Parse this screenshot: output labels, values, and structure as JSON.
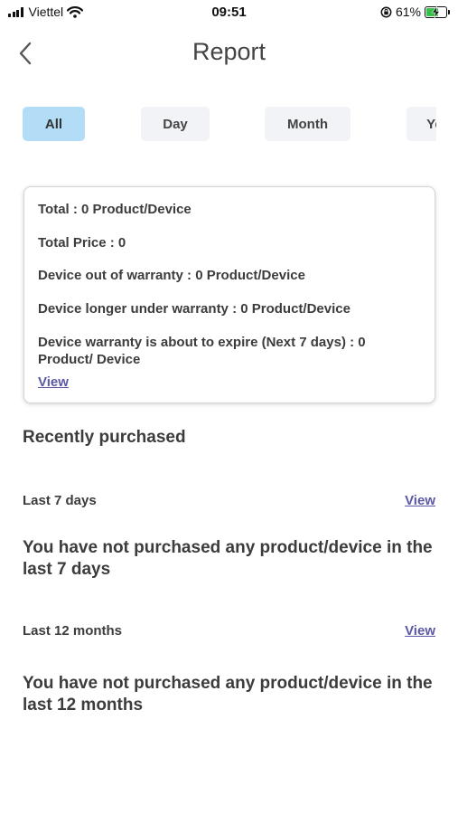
{
  "status_bar": {
    "carrier": "Viettel",
    "time": "09:51",
    "battery": "61%",
    "battery_level": 0.61,
    "icons": [
      "signal-icon",
      "wifi-icon",
      "orientation-lock-icon",
      "battery-charging-icon"
    ]
  },
  "header": {
    "title": "Report",
    "back_icon": "chevron-left-icon"
  },
  "tabs": [
    {
      "label": "All",
      "active": true
    },
    {
      "label": "Day",
      "active": false
    },
    {
      "label": "Month",
      "active": false
    },
    {
      "label": "Year",
      "active": false
    }
  ],
  "summary": {
    "total": "Total : 0 Product/Device",
    "total_price": "Total Price : 0",
    "out_of_warranty": "Device out of warranty : 0 Product/Device",
    "under_warranty": "Device longer under warranty : 0 Product/Device",
    "about_to_expire": "Device warranty is about to expire (Next 7 days) : 0 Product/ Device",
    "view_label": "View"
  },
  "recent": {
    "title": "Recently purchased",
    "last7": {
      "label": "Last 7 days",
      "view_label": "View",
      "empty_message": "You have not purchased any product/device in the last 7 days"
    },
    "last12": {
      "label": "Last 12 months",
      "view_label": "View",
      "empty_message": "You have not purchased any product/device in the last 12 months"
    }
  },
  "colors": {
    "active_tab": "#b3dcf6",
    "inactive_tab": "#f2f3f6",
    "link": "#5b58a6",
    "battery_fill": "#36c24a"
  }
}
